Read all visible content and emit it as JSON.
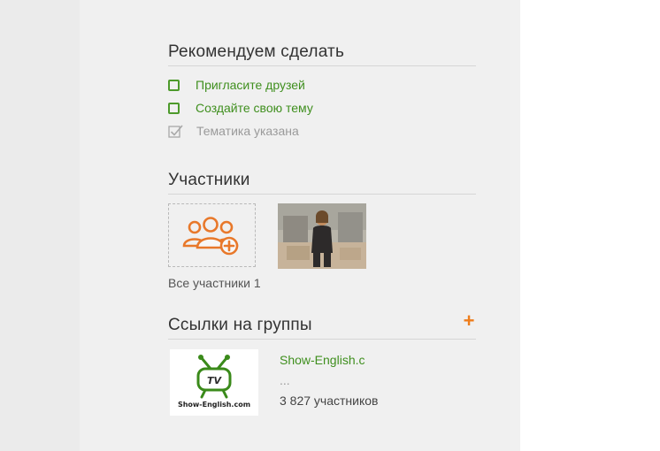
{
  "recommend": {
    "title": "Рекомендуем сделать",
    "items": [
      {
        "label": "Пригласите друзей",
        "state": "todo"
      },
      {
        "label": "Создайте свою тему",
        "state": "todo"
      },
      {
        "label": "Тематика указана",
        "state": "done"
      }
    ]
  },
  "members": {
    "title": "Участники",
    "add_icon": "add-users-icon",
    "all_label": "Все участники 1"
  },
  "groups": {
    "title": "Ссылки на группы",
    "add_label": "+",
    "item": {
      "name": "Show-English.c",
      "description": "...",
      "members": "3 827 участников",
      "logo_text_top": "TV",
      "logo_text_bottom": "Show-English.com"
    }
  },
  "colors": {
    "link_green": "#3f8f1e",
    "accent_orange": "#ee7d1c",
    "muted_gray": "#9a9a9a"
  }
}
